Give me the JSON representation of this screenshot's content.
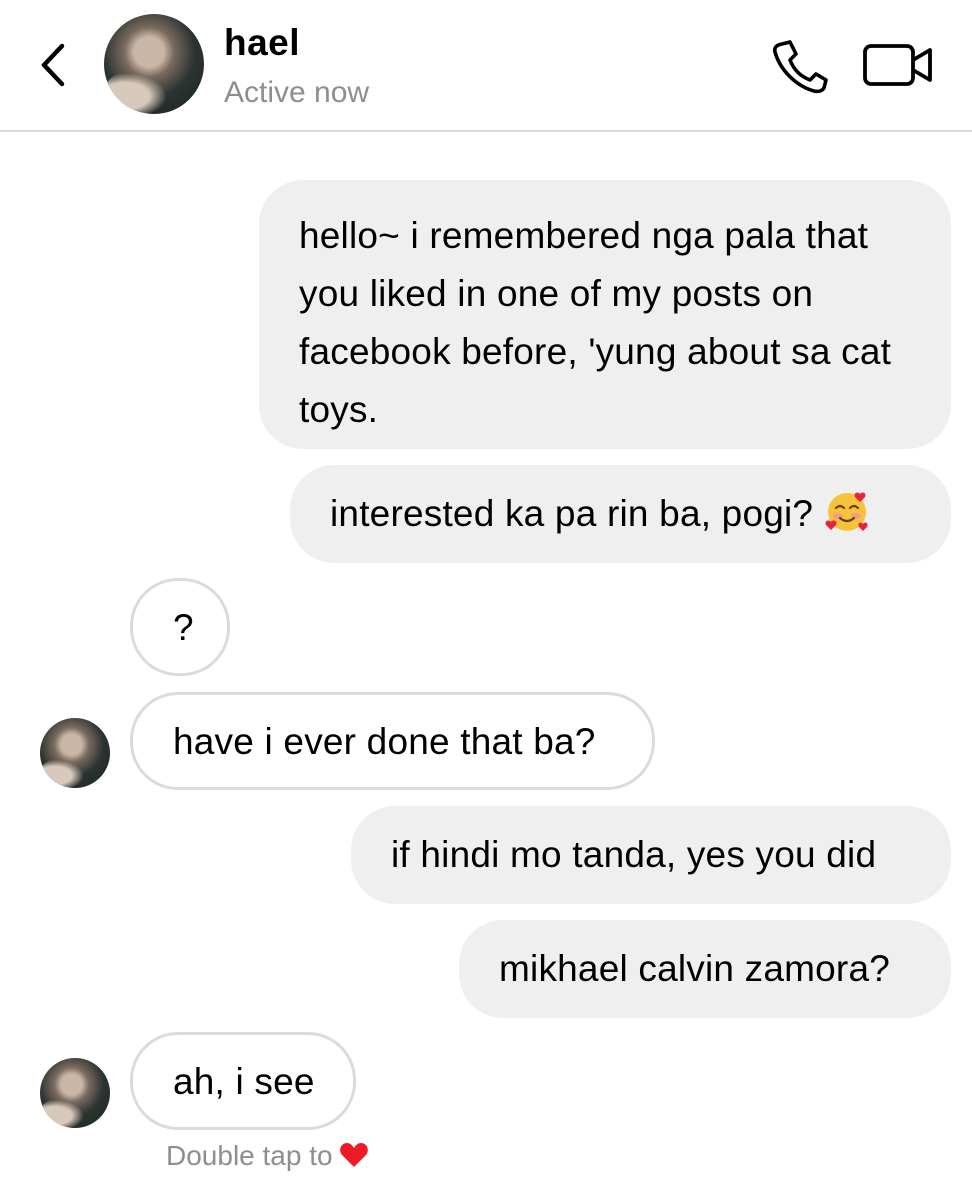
{
  "header": {
    "name": "hael",
    "status": "Active now",
    "back_icon": "chevron-left-icon",
    "call_icon": "phone-icon",
    "video_icon": "video-camera-icon"
  },
  "messages": [
    {
      "from": "me",
      "text": "hello~ i remembered nga pala that you liked in one of my posts on facebook before, 'yung about sa cat toys."
    },
    {
      "from": "me",
      "text": "interested ka pa rin ba, pogi?",
      "emoji": "smiling-face-with-hearts"
    },
    {
      "from": "them",
      "text": "?"
    },
    {
      "from": "them",
      "text": "have i ever done that ba?"
    },
    {
      "from": "me",
      "text": "if hindi mo tanda, yes you did"
    },
    {
      "from": "me",
      "text": "mikhael calvin zamora?"
    },
    {
      "from": "them",
      "text": "ah, i see"
    }
  ],
  "footer": {
    "hint": "Double tap to",
    "hint_icon": "heart-icon"
  },
  "colors": {
    "outgoing_bubble": "#efefef",
    "incoming_border": "#dbdbdb",
    "muted_text": "#8e8e8e",
    "heart": "#ed1c24"
  }
}
